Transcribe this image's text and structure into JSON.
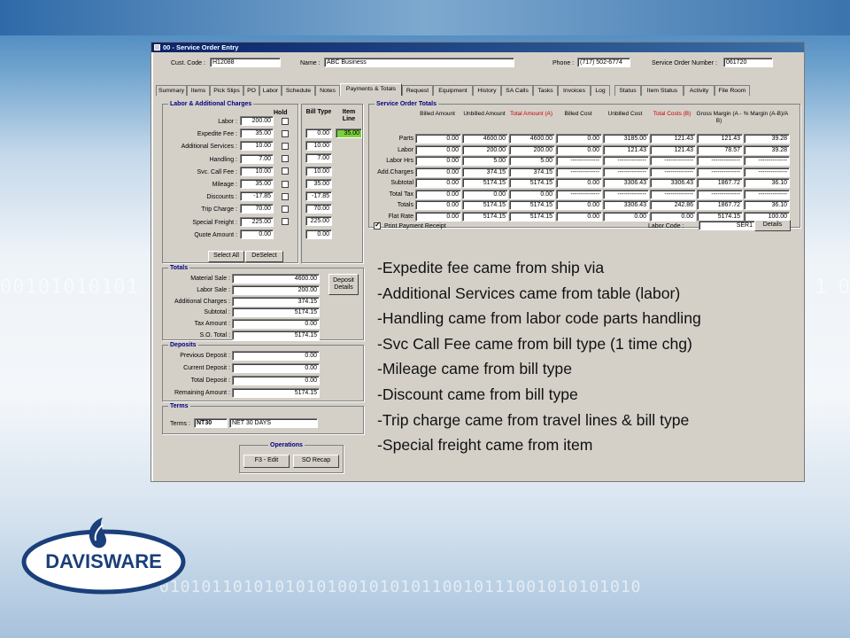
{
  "background_binary": {
    "left": "00101010101",
    "right": "0 1 0",
    "bottom": "0101011010101010100101010110010111001010101010"
  },
  "window": {
    "title": "00 - Service Order Entry"
  },
  "header": {
    "cust_code_label": "Cust. Code :",
    "cust_code": "H12088",
    "name_label": "Name :",
    "name": "ABC Business",
    "phone_label": "Phone :",
    "phone": "(717) 502-6774",
    "so_number_label": "Service Order Number :",
    "so_number": "061720"
  },
  "tabs": [
    "Summary",
    "Items",
    "Pick Slips",
    "PO",
    "Labor",
    "Schedule",
    "Notes",
    "Payments & Totals",
    "Request",
    "Equipment",
    "History",
    "SA Calls",
    "Tasks",
    "Invoices",
    "Log",
    "Status",
    "Item Status",
    "Activity",
    "File Room"
  ],
  "labor_group": {
    "title": "Labor & Additional Charges",
    "hold_label": "Hold",
    "bill_type_label": "Bill Type",
    "item_line_label": "Item Line",
    "rows": [
      {
        "label": "Labor :",
        "value": "200.00",
        "bill": "0.00",
        "item": "35.00"
      },
      {
        "label": "Expedite Fee :",
        "value": "35.00",
        "bill": "10.00",
        "item": ""
      },
      {
        "label": "Additional Services :",
        "value": "10.00",
        "bill": "7.00",
        "item": ""
      },
      {
        "label": "Handling :",
        "value": "7.00",
        "bill": "10.00",
        "item": ""
      },
      {
        "label": "Svc. Call Fee :",
        "value": "10.00",
        "bill": "35.00",
        "item": ""
      },
      {
        "label": "Mileage :",
        "value": "35.00",
        "bill": "-17.85",
        "item": ""
      },
      {
        "label": "Discounts :",
        "value": "-17.85",
        "bill": "70.00",
        "item": ""
      },
      {
        "label": "Trip Charge :",
        "value": "70.00",
        "bill": "225.00",
        "item": ""
      },
      {
        "label": "Special Freight :",
        "value": "225.00",
        "bill": "0.00",
        "item": ""
      },
      {
        "label": "Quote Amount :",
        "value": "0.00",
        "bill": "",
        "item": ""
      }
    ],
    "select_all": "Select All",
    "deselect": "DeSelect"
  },
  "totals_group": {
    "title": "Totals",
    "rows": [
      {
        "label": "Material Sale :",
        "value": "4600.00"
      },
      {
        "label": "Labor Sale :",
        "value": "200.00"
      },
      {
        "label": "Additional Charges :",
        "value": "374.15"
      },
      {
        "label": "Subtotal :",
        "value": "5174.15"
      },
      {
        "label": "Tax Amount :",
        "value": "0.00"
      },
      {
        "label": "S.O. Total :",
        "value": "5174.15"
      }
    ],
    "deposit_details": "Deposit Details"
  },
  "deposits_group": {
    "title": "Deposits",
    "rows": [
      {
        "label": "Previous Deposit :",
        "value": "0.00"
      },
      {
        "label": "Current  Deposit :",
        "value": "0.00"
      },
      {
        "label": "Total Deposit :",
        "value": "0.00"
      },
      {
        "label": "Remaining Amount :",
        "value": "5174.15"
      }
    ]
  },
  "terms_group": {
    "title": "Terms",
    "label": "Terms :",
    "code": "NT30",
    "desc": "NET 30 DAYS"
  },
  "operations_group": {
    "title": "Operations",
    "edit": "F3 - Edit",
    "recap": "SO Recap"
  },
  "so_totals": {
    "title": "Service Order Totals",
    "columns": [
      {
        "label": "Billed Amount",
        "red": false
      },
      {
        "label": "Unbilled Amount",
        "red": false
      },
      {
        "label": "Total Amount (A)",
        "red": true
      },
      {
        "label": "Billed Cost",
        "red": false
      },
      {
        "label": "Unbilled Cost",
        "red": false
      },
      {
        "label": "Total Costs (B)",
        "red": true
      },
      {
        "label": "Gross Margin (A - B)",
        "red": false
      },
      {
        "label": "% Margin (A-B)/A",
        "red": false
      }
    ],
    "rows": [
      {
        "label": "Parts",
        "cells": [
          "0.00",
          "4600.00",
          "4600.00",
          "0.00",
          "3185.00",
          "121.43",
          "121.43",
          "39.28"
        ]
      },
      {
        "label": "Labor",
        "cells": [
          "0.00",
          "200.00",
          "200.00",
          "0.00",
          "121.43",
          "121.43",
          "78.57",
          "39.28"
        ]
      },
      {
        "label": "Labor Hrs",
        "cells": [
          "0.00",
          "5.00",
          "5.00",
          "--------------",
          "--------------",
          "--------------",
          "--------------",
          "--------------"
        ]
      },
      {
        "label": "Add.Charges",
        "cells": [
          "0.00",
          "374.15",
          "374.15",
          "--------------",
          "--------------",
          "--------------",
          "--------------",
          "--------------"
        ]
      },
      {
        "label": "Subtotal",
        "cells": [
          "0.00",
          "5174.15",
          "5174.15",
          "0.00",
          "3306.43",
          "3306.43",
          "1867.72",
          "36.10"
        ]
      },
      {
        "label": "Total Tax",
        "cells": [
          "0.00",
          "0.00",
          "0.00",
          "--------------",
          "--------------",
          "--------------",
          "--------------",
          "--------------"
        ]
      },
      {
        "label": "Totals",
        "cells": [
          "0.00",
          "5174.15",
          "5174.15",
          "0.00",
          "3306.43",
          "242.86",
          "1867.72",
          "36.10"
        ]
      },
      {
        "label": "Flat Rate",
        "cells": [
          "0.00",
          "5174.15",
          "5174.15",
          "0.00",
          "0.00",
          "0.00",
          "5174.15",
          "100.00"
        ]
      }
    ],
    "print_receipt": "Print Payment Receipt",
    "labor_code_label": "Labor Code :",
    "labor_code": "SER1",
    "details": "Details"
  },
  "notes": [
    "-Expedite fee came from ship via",
    "-Additional Services came from table (labor)",
    "-Handling came from labor code parts handling",
    "-Svc Call Fee came from bill type (1 time chg)",
    "-Mileage came from bill type",
    "-Discount came from bill type",
    "-Trip charge came from travel lines & bill type",
    "-Special freight came from item"
  ],
  "logo": {
    "text": "DAVISWARE"
  },
  "colors": {
    "accent_red": "#cc0000",
    "group_title": "#000080",
    "highlight_green": "#7cd13a",
    "logo_blue": "#1a3f7a"
  }
}
